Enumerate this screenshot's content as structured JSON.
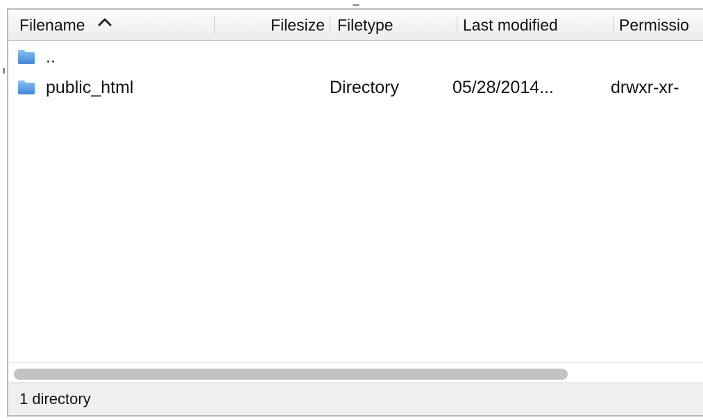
{
  "header": {
    "columns": {
      "filename": "Filename",
      "filesize": "Filesize",
      "filetype": "Filetype",
      "last_modified": "Last modified",
      "permissions": "Permissio"
    },
    "sort_icon": "chevron-up-icon"
  },
  "rows": [
    {
      "icon": "folder-icon",
      "name": "..",
      "size": "",
      "type": "",
      "modified": "",
      "permissions": ""
    },
    {
      "icon": "folder-icon",
      "name": "public_html",
      "size": "",
      "type": "Directory",
      "modified": "05/28/2014...",
      "permissions": "drwxr-xr-"
    }
  ],
  "status": {
    "text": "1 directory"
  },
  "colors": {
    "folder": "#5aa0e8",
    "scroll_thumb": "#c3c3c3",
    "status_bg": "#efefef"
  }
}
